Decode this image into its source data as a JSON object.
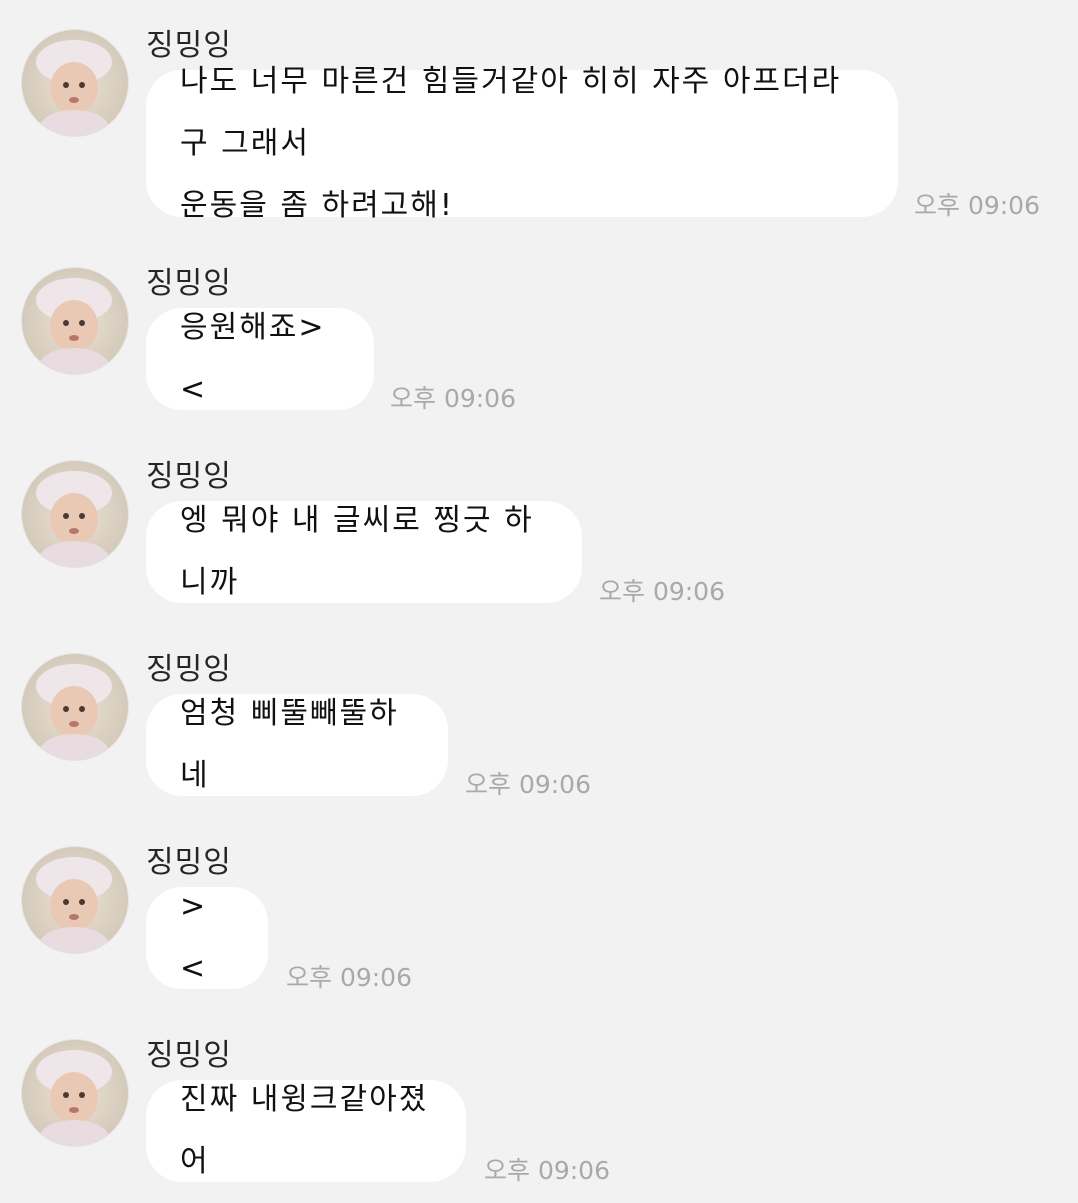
{
  "messages": [
    {
      "sender": "징밍잉",
      "text": "나도 너무 마른건 힘들거같아 히히 자주 아프더라구 그래서\n운동을 좀 하려고해!",
      "time": "오후 09:06"
    },
    {
      "sender": "징밍잉",
      "text": "응원해죠><",
      "time": "오후 09:06"
    },
    {
      "sender": "징밍잉",
      "text": "엥 뭐야 내 글씨로 찡긋 하니까",
      "time": "오후 09:06"
    },
    {
      "sender": "징밍잉",
      "text": "엄청 삐뚤빼뚤하네",
      "time": "오후 09:06"
    },
    {
      "sender": "징밍잉",
      "text": "><",
      "time": "오후 09:06"
    },
    {
      "sender": "징밍잉",
      "text": "진짜 내윙크같아졌어",
      "time": "오후 09:06"
    }
  ],
  "avatar_icon": "baby-photo-avatar",
  "colors": {
    "background": "#f2f2f2",
    "bubble": "#ffffff",
    "time": "#a9a9a9",
    "text": "#111111"
  }
}
